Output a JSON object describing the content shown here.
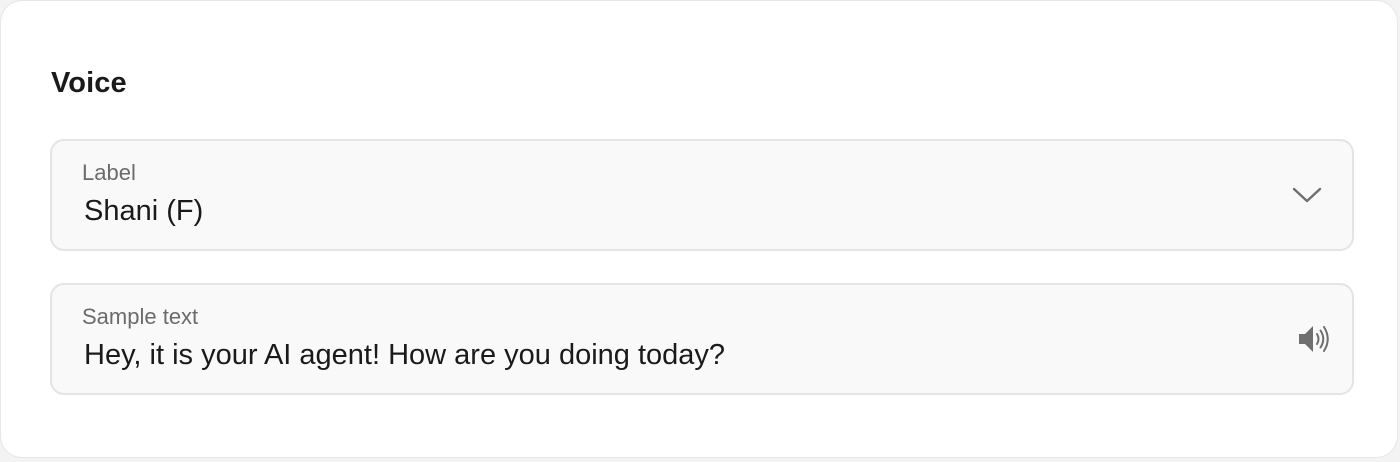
{
  "voice_section": {
    "title": "Voice",
    "voice_select": {
      "label": "Label",
      "value": "Shani (F)",
      "icon": "chevron-down-icon"
    },
    "sample_text": {
      "label": "Sample text",
      "value": "Hey, it is your AI agent! How are you doing today?",
      "icon": "speaker-icon"
    }
  },
  "colors": {
    "title_text": "#1a1a1a",
    "label_text": "#6b6b6b",
    "field_background": "#f9f9f9",
    "field_border": "#e4e4e4",
    "icon": "#6f6f6f"
  }
}
